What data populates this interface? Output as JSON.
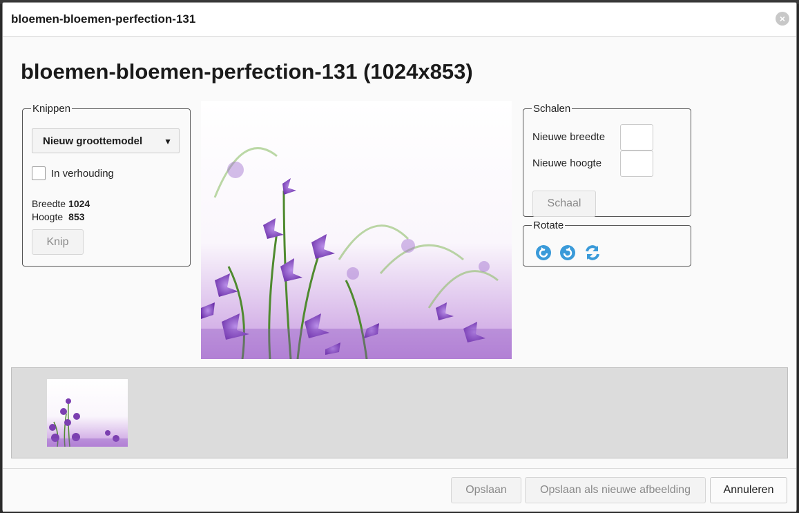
{
  "dialog": {
    "title": "bloemen-bloemen-perfection-131",
    "heading": "bloemen-bloemen-perfection-131 (1024x853)",
    "close_icon": "close-icon"
  },
  "knippen": {
    "legend": "Knippen",
    "select_value": "Nieuw groottemodel",
    "checkbox_label": "In verhouding",
    "breedte_label": "Breedte",
    "breedte_value": "1024",
    "hoogte_label": "Hoogte",
    "hoogte_value": "853",
    "button": "Knip"
  },
  "schalen": {
    "legend": "Schalen",
    "width_label": "Nieuwe breedte",
    "height_label": "Nieuwe hoogte",
    "button": "Schaal"
  },
  "rotate": {
    "legend": "Rotate",
    "icons": [
      "rotate-left-icon",
      "rotate-right-icon",
      "flip-icon"
    ]
  },
  "footer": {
    "save": "Opslaan",
    "save_new": "Opslaan als nieuwe afbeelding",
    "cancel": "Annuleren"
  },
  "colors": {
    "accent_icon": "#3a9ad9",
    "flower_purple": "#7b3fb0",
    "stem_green": "#5f9a3a"
  }
}
